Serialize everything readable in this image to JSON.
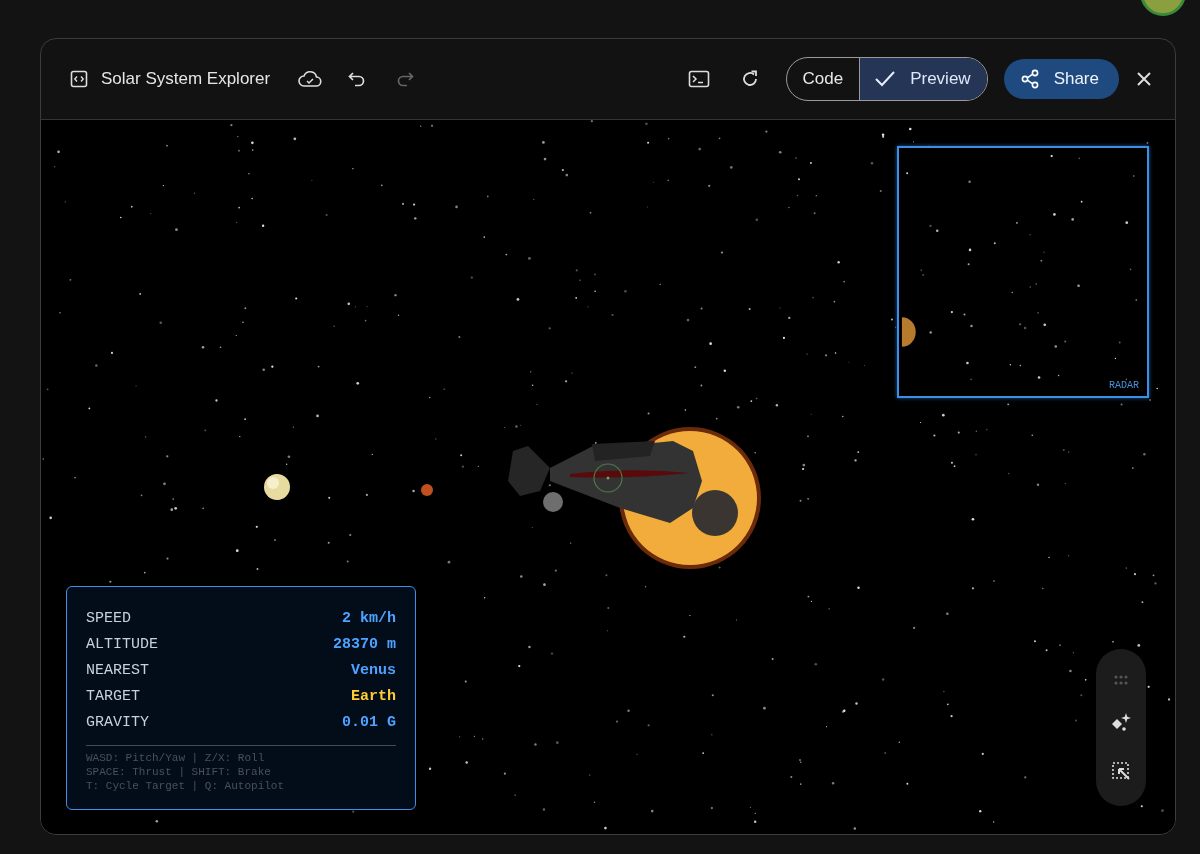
{
  "header": {
    "title": "Solar System Explorer",
    "view_toggle": [
      {
        "label": "Code",
        "selected": false
      },
      {
        "label": "Preview",
        "selected": true
      }
    ],
    "share": "Share"
  },
  "radar": {
    "label": "RADAR"
  },
  "hud": {
    "rows": [
      {
        "label": "SPEED",
        "value": "2 km/h",
        "color": "#4da3ff"
      },
      {
        "label": "ALTITUDE",
        "value": "28370 m",
        "color": "#4da3ff"
      },
      {
        "label": "NEAREST",
        "value": "Venus",
        "color": "#4da3ff"
      },
      {
        "label": "TARGET",
        "value": "Earth",
        "color": "#ffcc33"
      },
      {
        "label": "GRAVITY",
        "value": "0.01 G",
        "color": "#4da3ff"
      }
    ],
    "help": [
      "WASD: Pitch/Yaw | Z/X: Roll",
      "SPACE: Thrust | SHIFT: Brake",
      "T: Cycle Target | Q: Autopilot"
    ]
  }
}
